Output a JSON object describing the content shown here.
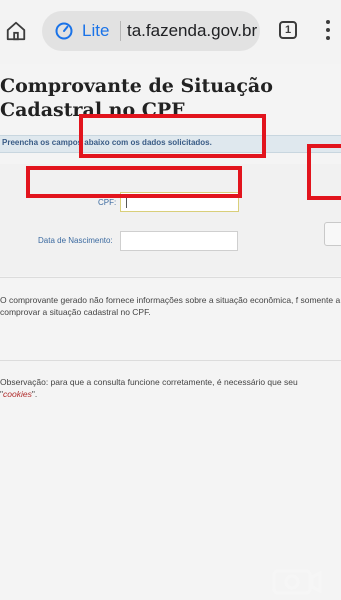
{
  "browser": {
    "lite_label": "Lite",
    "url": "ta.fazenda.gov.br",
    "tab_count": "1",
    "icons": [
      "home-icon",
      "lite-speedometer-icon",
      "tabs-icon",
      "more-vert-icon"
    ]
  },
  "page": {
    "title": "Comprovante de Situação Cadastral no CPF",
    "info_message": "Preencha os campos abaixo com os dados solicitados.",
    "form": {
      "cpf_label": "CPF:",
      "cpf_value": "",
      "birth_label": "Data de Nascimento:",
      "birth_value": ""
    },
    "notice_text": "O comprovante gerado não fornece informações sobre a situação econômica, f somente a comprovar a situação cadastral no CPF.",
    "observation_text": "Observação: para que a consulta funcione corretamente, é necessário que seu",
    "observation_link": "cookies",
    "observation_suffix": "\".",
    "observation_prefix_quote": "\""
  },
  "colors": {
    "highlight": "#e2141d",
    "accent": "#1a73e8",
    "info_bar": "#dfe8ee",
    "link": "#b02a2a"
  }
}
